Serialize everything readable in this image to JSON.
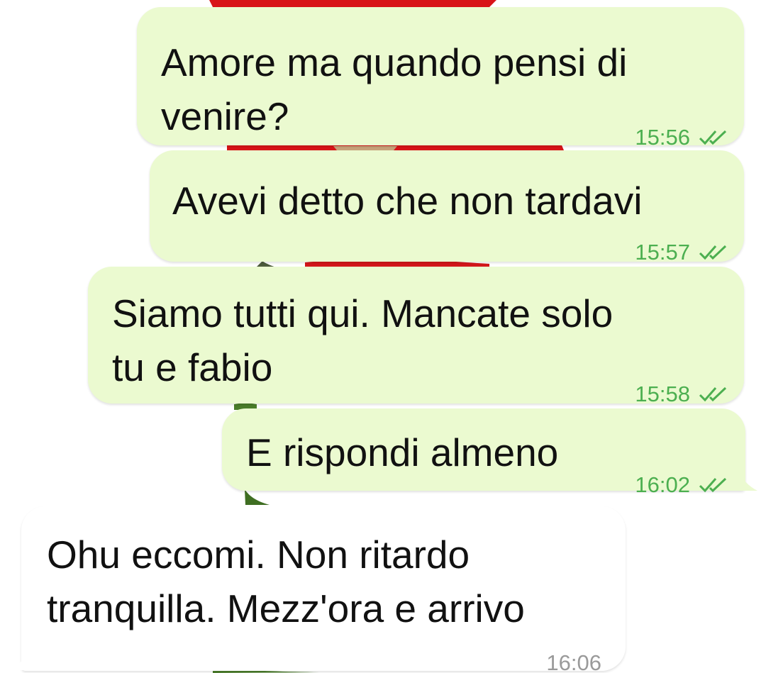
{
  "messages": [
    {
      "direction": "outgoing",
      "text": "Amore ma quando pensi di\nvenire?",
      "time": "15:56",
      "status": "read"
    },
    {
      "direction": "outgoing",
      "text": "Avevi detto che non tardavi",
      "time": "15:57",
      "status": "read"
    },
    {
      "direction": "outgoing",
      "text": "Siamo tutti qui. Mancate solo\ntu e fabio",
      "time": "15:58",
      "status": "read"
    },
    {
      "direction": "outgoing",
      "text": "E rispondi almeno",
      "time": "16:02",
      "status": "read"
    },
    {
      "direction": "incoming",
      "text": "Ohu eccomi. Non ritardo\ntranquilla. Mezz'ora e arrivo",
      "time": "16:06"
    }
  ],
  "colors": {
    "outgoing_bubble": "#ebfad0",
    "incoming_bubble": "#ffffff",
    "read_ticks": "#4caf50",
    "outgoing_time": "#4caf50",
    "incoming_time": "#9a9a9a",
    "wallpaper_petals": "#e0131a",
    "wallpaper_stem": "#4a7d2a"
  },
  "icons": {
    "read_receipt": "double-check-icon",
    "wallpaper": "red-rose-wallpaper"
  }
}
